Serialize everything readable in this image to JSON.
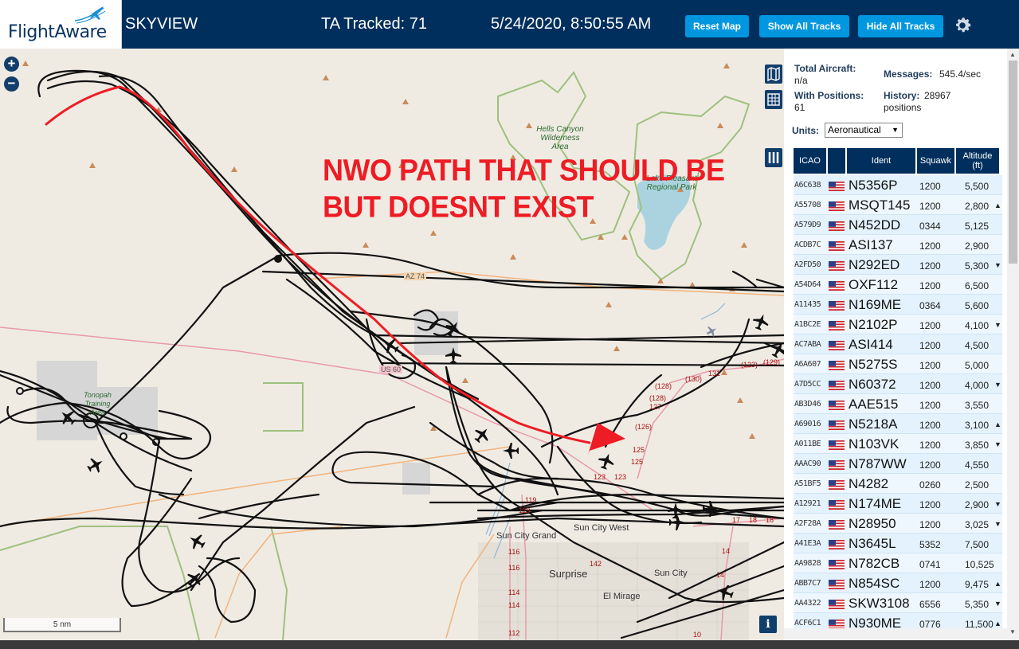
{
  "header": {
    "logo_text": "FlightAware",
    "app_title": "SKYVIEW",
    "tracked": "TA Tracked: 71",
    "datetime": "5/24/2020, 8:50:55 AM",
    "reset_label": "Reset Map",
    "show_label": "Show All Tracks",
    "hide_label": "Hide All Tracks"
  },
  "map": {
    "annotation_line1": "NWO PATH THAT SHOULD BE",
    "annotation_line2": "BUT DOESNT EXIST",
    "scale_label": "5 nm",
    "info_label": "i",
    "places": [
      {
        "name": "Surprise"
      },
      {
        "name": "Sun City"
      },
      {
        "name": "El Mirage"
      },
      {
        "name": "Sun City Grand"
      },
      {
        "name": "Sun City West"
      }
    ],
    "parks": [
      {
        "name": "Hells Canyon Wilderness Area"
      },
      {
        "name": "Lake Pleasant Regional Park"
      },
      {
        "name": "Tonopah Training Area"
      }
    ],
    "roads": [
      "AZ 74",
      "US 60"
    ],
    "route_numbers": [
      "131",
      "(130)",
      "(129)",
      "(123)",
      "(128)",
      "(128)",
      "127",
      "(126)",
      "125",
      "125",
      "123",
      "123",
      "119",
      "119",
      "116",
      "116",
      "114",
      "114",
      "112",
      "142",
      "14",
      "14",
      "10",
      "17",
      "18",
      "18"
    ]
  },
  "colors": {
    "header_bg": "#002f5d",
    "button_bg": "#0097e0",
    "annotation": "#ee1c24",
    "track": "#111111"
  },
  "panel": {
    "total_label": "Total Aircraft:",
    "total_value": "n/a",
    "messages_label": "Messages:",
    "messages_value": "545.4/sec",
    "positions_label": "With Positions:",
    "positions_value": "61",
    "history_label": "History:",
    "history_value": "28967",
    "history_unit": "positions",
    "units_label": "Units:",
    "units_value": "Aeronautical",
    "columns": {
      "icao": "ICAO",
      "ident": "Ident",
      "squawk": "Squawk",
      "altitude": "Altitude",
      "altitude_unit": "(ft)"
    },
    "aircraft": [
      {
        "icao": "A6C638",
        "ident": "N5356P",
        "squawk": "1200",
        "alt": "5,500",
        "trend": ""
      },
      {
        "icao": "A55708",
        "ident": "MSQT145",
        "squawk": "1200",
        "alt": "2,800",
        "trend": "▲"
      },
      {
        "icao": "A579D9",
        "ident": "N452DD",
        "squawk": "0344",
        "alt": "5,125",
        "trend": ""
      },
      {
        "icao": "ACDB7C",
        "ident": "ASI137",
        "squawk": "1200",
        "alt": "2,900",
        "trend": ""
      },
      {
        "icao": "A2FD50",
        "ident": "N292ED",
        "squawk": "1200",
        "alt": "5,300",
        "trend": "▼"
      },
      {
        "icao": "A54D64",
        "ident": "OXF112",
        "squawk": "1200",
        "alt": "6,500",
        "trend": ""
      },
      {
        "icao": "A11435",
        "ident": "N169ME",
        "squawk": "0364",
        "alt": "5,600",
        "trend": ""
      },
      {
        "icao": "A1BC2E",
        "ident": "N2102P",
        "squawk": "1200",
        "alt": "4,100",
        "trend": "▼"
      },
      {
        "icao": "AC7ABA",
        "ident": "ASI414",
        "squawk": "1200",
        "alt": "4,500",
        "trend": ""
      },
      {
        "icao": "A6A607",
        "ident": "N5275S",
        "squawk": "1200",
        "alt": "5,000",
        "trend": ""
      },
      {
        "icao": "A7D5CC",
        "ident": "N60372",
        "squawk": "1200",
        "alt": "4,000",
        "trend": "▼"
      },
      {
        "icao": "AB3D46",
        "ident": "AAE515",
        "squawk": "1200",
        "alt": "3,550",
        "trend": ""
      },
      {
        "icao": "A69016",
        "ident": "N5218A",
        "squawk": "1200",
        "alt": "3,100",
        "trend": "▲"
      },
      {
        "icao": "A011BE",
        "ident": "N103VK",
        "squawk": "1200",
        "alt": "3,850",
        "trend": "▼"
      },
      {
        "icao": "AAAC90",
        "ident": "N787WW",
        "squawk": "1200",
        "alt": "4,550",
        "trend": ""
      },
      {
        "icao": "A51BF5",
        "ident": "N4282",
        "squawk": "0260",
        "alt": "2,500",
        "trend": ""
      },
      {
        "icao": "A12921",
        "ident": "N174ME",
        "squawk": "1200",
        "alt": "2,900",
        "trend": "▼"
      },
      {
        "icao": "A2F28A",
        "ident": "N28950",
        "squawk": "1200",
        "alt": "3,025",
        "trend": "▼"
      },
      {
        "icao": "A41E3A",
        "ident": "N3645L",
        "squawk": "5352",
        "alt": "7,500",
        "trend": ""
      },
      {
        "icao": "AA9828",
        "ident": "N782CB",
        "squawk": "0741",
        "alt": "10,525",
        "trend": ""
      },
      {
        "icao": "ABB7C7",
        "ident": "N854SC",
        "squawk": "1200",
        "alt": "9,475",
        "trend": "▲"
      },
      {
        "icao": "AA4322",
        "ident": "SKW3108",
        "squawk": "6556",
        "alt": "5,350",
        "trend": "▼"
      },
      {
        "icao": "ACF6C1",
        "ident": "N930ME",
        "squawk": "0776",
        "alt": "11,500",
        "trend": "▲"
      }
    ]
  }
}
